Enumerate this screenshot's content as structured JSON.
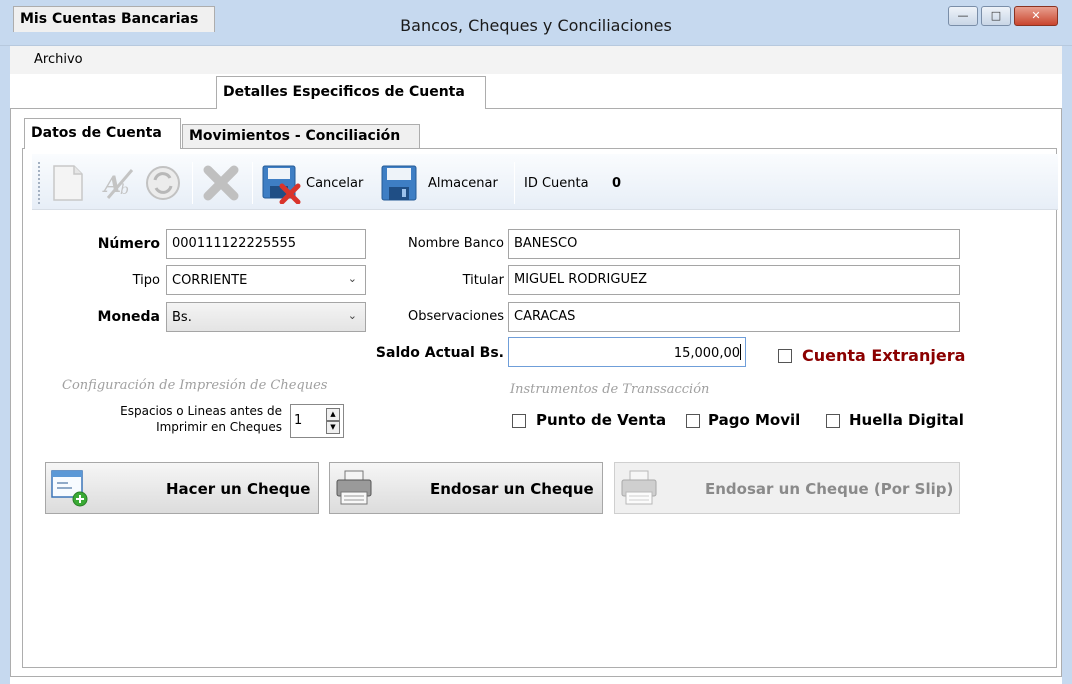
{
  "window": {
    "title": "Bancos, Cheques y Conciliaciones"
  },
  "menu": {
    "items": [
      "Archivo"
    ]
  },
  "outer_tabs": [
    "Mis Cuentas Bancarias",
    "Detalles Especificos de Cuenta"
  ],
  "inner_tabs": [
    "Datos de Cuenta",
    "Movimientos - Conciliación"
  ],
  "toolbar": {
    "cancel_label": "Cancelar",
    "save_label": "Almacenar",
    "id_label": "ID Cuenta",
    "id_value": "0"
  },
  "form": {
    "numero": {
      "label": "Número",
      "value": "000111122225555"
    },
    "tipo": {
      "label": "Tipo",
      "value": "CORRIENTE"
    },
    "moneda": {
      "label": "Moneda",
      "value": "Bs."
    },
    "nombre_banco": {
      "label": "Nombre Banco",
      "value": "BANESCO"
    },
    "titular": {
      "label": "Titular",
      "value": "MIGUEL RODRIGUEZ"
    },
    "observaciones": {
      "label": "Observaciones",
      "value": "CARACAS"
    },
    "saldo": {
      "label": "Saldo Actual Bs.",
      "value": "15,000,00"
    },
    "cuenta_extranjera": {
      "label": "Cuenta Extranjera",
      "checked": false
    }
  },
  "print_config": {
    "title": "Configuración de Impresión de Cheques",
    "spaces_label_1": "Espacios o Lineas antes de",
    "spaces_label_2": "Imprimir en Cheques",
    "spaces_value": "1"
  },
  "instruments": {
    "title": "Instrumentos de Transsacción",
    "options": [
      {
        "label": "Punto de Venta",
        "checked": false
      },
      {
        "label": "Pago Movil",
        "checked": false
      },
      {
        "label": "Huella Digital",
        "checked": false
      }
    ]
  },
  "actions": {
    "make_check": "Hacer un Cheque",
    "endorse_check": "Endosar un Cheque",
    "endorse_slip": "Endosar un Cheque (Por Slip)"
  },
  "colors": {
    "accent_red": "#8b0000",
    "disabled_text": "#a0a0a0"
  }
}
